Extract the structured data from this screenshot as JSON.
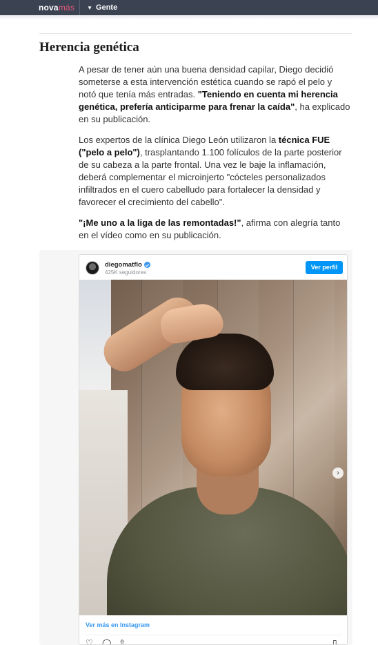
{
  "nav": {
    "logo_part1": "nova",
    "logo_part2": "más",
    "section_label": "Gente"
  },
  "article": {
    "heading": "Herencia genética",
    "p1_a": "A pesar de tener aún una buena densidad capilar, Diego decidió someterse a esta intervención estética cuando se rapó el pelo y notó que tenía más entradas. ",
    "p1_b": "\"Teniendo en cuenta mi herencia genética, prefería anticiparme para frenar la caída\"",
    "p1_c": ", ha explicado en su publicación.",
    "p2_a": "Los expertos de la clínica Diego León utilizaron la ",
    "p2_b": "técnica FUE (\"pelo a pelo\")",
    "p2_c": ", trasplantando 1.100 folículos de la parte posterior de su cabeza a la parte frontal. Una vez le baje la inflamación, deberá complementar el microinjerto \"cócteles personalizados infiltrados en el cuero cabelludo para fortalecer la densidad y favorecer el crecimiento del cabello\".",
    "p3_a": "\"¡Me uno a la liga de las remontadas!\"",
    "p3_b": ", afirma con alegría tanto en el vídeo como en su publicación."
  },
  "instagram": {
    "username": "diegomatflo",
    "followers": "425K seguidores",
    "view_profile": "Ver perfil",
    "view_more": "Ver más en Instagram",
    "carousel_position": 1,
    "carousel_count": 3,
    "icons": [
      "heart-icon",
      "comment-icon",
      "share-icon",
      "bookmark-icon"
    ]
  },
  "colors": {
    "nav_bg": "#3b4252",
    "logo_accent": "#e0567a",
    "ig_blue": "#0095f6"
  }
}
